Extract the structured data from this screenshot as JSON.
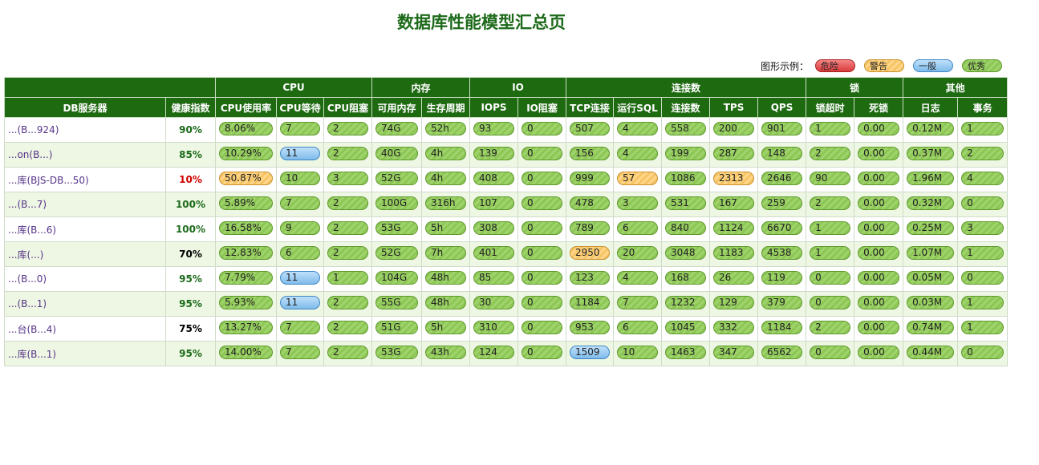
{
  "title": "数据库性能模型汇总页",
  "legend": {
    "label": "图形示例：",
    "items": [
      {
        "label": "危险",
        "level": "danger"
      },
      {
        "label": "警告",
        "level": "warn"
      },
      {
        "label": "一般",
        "level": "norm"
      },
      {
        "label": "优秀",
        "level": "good"
      }
    ]
  },
  "colors": {
    "header_bg": "#1e6a11",
    "alt_row": "#eef7e3",
    "good": "#8cc654",
    "warn": "#f6c463",
    "normal": "#7fbbea",
    "danger": "#d93b3b"
  },
  "table": {
    "groups": [
      "CPU",
      "内存",
      "IO",
      "连接数",
      "锁",
      "其他"
    ],
    "columns": [
      "DB服务器",
      "健康指数",
      "CPU使用率",
      "CPU等待",
      "CPU阻塞",
      "可用内存",
      "生存周期",
      "IOPS",
      "IO阻塞",
      "TCP连接",
      "运行SQL",
      "连接数",
      "TPS",
      "QPS",
      "锁超时",
      "死锁",
      "日志",
      "事务"
    ],
    "rows": [
      {
        "server": "...(B...924)",
        "health": "90%",
        "hlevel": "good",
        "cells": [
          [
            "8.06%",
            "good"
          ],
          [
            "7",
            "good"
          ],
          [
            "2",
            "good"
          ],
          [
            "74G",
            "good"
          ],
          [
            "52h",
            "good"
          ],
          [
            "93",
            "good"
          ],
          [
            "0",
            "good"
          ],
          [
            "507",
            "good"
          ],
          [
            "4",
            "good"
          ],
          [
            "558",
            "good"
          ],
          [
            "200",
            "good"
          ],
          [
            "901",
            "good"
          ],
          [
            "1",
            "good"
          ],
          [
            "0.00",
            "good"
          ],
          [
            "0.12M",
            "good"
          ],
          [
            "1",
            "good"
          ]
        ]
      },
      {
        "server": "...on(B...)",
        "health": "85%",
        "hlevel": "good",
        "cells": [
          [
            "10.29%",
            "good"
          ],
          [
            "11",
            "norm"
          ],
          [
            "2",
            "good"
          ],
          [
            "40G",
            "good"
          ],
          [
            "4h",
            "good"
          ],
          [
            "139",
            "good"
          ],
          [
            "0",
            "good"
          ],
          [
            "156",
            "good"
          ],
          [
            "4",
            "good"
          ],
          [
            "199",
            "good"
          ],
          [
            "287",
            "good"
          ],
          [
            "148",
            "good"
          ],
          [
            "2",
            "good"
          ],
          [
            "0.00",
            "good"
          ],
          [
            "0.37M",
            "good"
          ],
          [
            "2",
            "good"
          ]
        ]
      },
      {
        "server": "...库(BJS-DB...50)",
        "health": "10%",
        "hlevel": "bad",
        "cells": [
          [
            "50.87%",
            "warn"
          ],
          [
            "10",
            "good"
          ],
          [
            "3",
            "good"
          ],
          [
            "52G",
            "good"
          ],
          [
            "4h",
            "good"
          ],
          [
            "408",
            "good"
          ],
          [
            "0",
            "good"
          ],
          [
            "999",
            "good"
          ],
          [
            "57",
            "warn"
          ],
          [
            "1086",
            "good"
          ],
          [
            "2313",
            "warn"
          ],
          [
            "2646",
            "good"
          ],
          [
            "90",
            "good"
          ],
          [
            "0.00",
            "good"
          ],
          [
            "1.96M",
            "good"
          ],
          [
            "4",
            "good"
          ]
        ]
      },
      {
        "server": "...(B...7)",
        "health": "100%",
        "hlevel": "good",
        "cells": [
          [
            "5.89%",
            "good"
          ],
          [
            "7",
            "good"
          ],
          [
            "2",
            "good"
          ],
          [
            "100G",
            "good"
          ],
          [
            "316h",
            "good"
          ],
          [
            "107",
            "good"
          ],
          [
            "0",
            "good"
          ],
          [
            "478",
            "good"
          ],
          [
            "3",
            "good"
          ],
          [
            "531",
            "good"
          ],
          [
            "167",
            "good"
          ],
          [
            "259",
            "good"
          ],
          [
            "2",
            "good"
          ],
          [
            "0.00",
            "good"
          ],
          [
            "0.32M",
            "good"
          ],
          [
            "0",
            "good"
          ]
        ]
      },
      {
        "server": "...库(B...6)",
        "health": "100%",
        "hlevel": "good",
        "cells": [
          [
            "16.58%",
            "good"
          ],
          [
            "9",
            "good"
          ],
          [
            "2",
            "good"
          ],
          [
            "53G",
            "good"
          ],
          [
            "5h",
            "good"
          ],
          [
            "308",
            "good"
          ],
          [
            "0",
            "good"
          ],
          [
            "789",
            "good"
          ],
          [
            "6",
            "good"
          ],
          [
            "840",
            "good"
          ],
          [
            "1124",
            "good"
          ],
          [
            "6670",
            "good"
          ],
          [
            "1",
            "good"
          ],
          [
            "0.00",
            "good"
          ],
          [
            "0.25M",
            "good"
          ],
          [
            "3",
            "good"
          ]
        ]
      },
      {
        "server": "...库(...)",
        "health": "70%",
        "hlevel": "norm",
        "cells": [
          [
            "12.83%",
            "good"
          ],
          [
            "6",
            "good"
          ],
          [
            "2",
            "good"
          ],
          [
            "52G",
            "good"
          ],
          [
            "7h",
            "good"
          ],
          [
            "401",
            "good"
          ],
          [
            "0",
            "good"
          ],
          [
            "2950",
            "warn"
          ],
          [
            "20",
            "good"
          ],
          [
            "3048",
            "good"
          ],
          [
            "1183",
            "good"
          ],
          [
            "4538",
            "good"
          ],
          [
            "1",
            "good"
          ],
          [
            "0.00",
            "good"
          ],
          [
            "1.07M",
            "good"
          ],
          [
            "1",
            "good"
          ]
        ]
      },
      {
        "server": "...(B...0)",
        "health": "95%",
        "hlevel": "good",
        "cells": [
          [
            "7.79%",
            "good"
          ],
          [
            "11",
            "norm"
          ],
          [
            "1",
            "good"
          ],
          [
            "104G",
            "good"
          ],
          [
            "48h",
            "good"
          ],
          [
            "85",
            "good"
          ],
          [
            "0",
            "good"
          ],
          [
            "123",
            "good"
          ],
          [
            "4",
            "good"
          ],
          [
            "168",
            "good"
          ],
          [
            "26",
            "good"
          ],
          [
            "119",
            "good"
          ],
          [
            "0",
            "good"
          ],
          [
            "0.00",
            "good"
          ],
          [
            "0.05M",
            "good"
          ],
          [
            "0",
            "good"
          ]
        ]
      },
      {
        "server": "...(B...1)",
        "health": "95%",
        "hlevel": "good",
        "cells": [
          [
            "5.93%",
            "good"
          ],
          [
            "11",
            "norm"
          ],
          [
            "2",
            "good"
          ],
          [
            "55G",
            "good"
          ],
          [
            "48h",
            "good"
          ],
          [
            "30",
            "good"
          ],
          [
            "0",
            "good"
          ],
          [
            "1184",
            "good"
          ],
          [
            "7",
            "good"
          ],
          [
            "1232",
            "good"
          ],
          [
            "129",
            "good"
          ],
          [
            "379",
            "good"
          ],
          [
            "0",
            "good"
          ],
          [
            "0.00",
            "good"
          ],
          [
            "0.03M",
            "good"
          ],
          [
            "1",
            "good"
          ]
        ]
      },
      {
        "server": "...台(B...4)",
        "health": "75%",
        "hlevel": "norm",
        "cells": [
          [
            "13.27%",
            "good"
          ],
          [
            "7",
            "good"
          ],
          [
            "2",
            "good"
          ],
          [
            "51G",
            "good"
          ],
          [
            "5h",
            "good"
          ],
          [
            "310",
            "good"
          ],
          [
            "0",
            "good"
          ],
          [
            "953",
            "good"
          ],
          [
            "6",
            "good"
          ],
          [
            "1045",
            "good"
          ],
          [
            "332",
            "good"
          ],
          [
            "1184",
            "good"
          ],
          [
            "2",
            "good"
          ],
          [
            "0.00",
            "good"
          ],
          [
            "0.74M",
            "good"
          ],
          [
            "1",
            "good"
          ]
        ]
      },
      {
        "server": "...库(B...1)",
        "health": "95%",
        "hlevel": "good",
        "cells": [
          [
            "14.00%",
            "good"
          ],
          [
            "7",
            "good"
          ],
          [
            "2",
            "good"
          ],
          [
            "53G",
            "good"
          ],
          [
            "43h",
            "good"
          ],
          [
            "124",
            "good"
          ],
          [
            "0",
            "good"
          ],
          [
            "1509",
            "norm"
          ],
          [
            "10",
            "good"
          ],
          [
            "1463",
            "good"
          ],
          [
            "347",
            "good"
          ],
          [
            "6562",
            "good"
          ],
          [
            "0",
            "good"
          ],
          [
            "0.00",
            "good"
          ],
          [
            "0.44M",
            "good"
          ],
          [
            "0",
            "good"
          ]
        ]
      }
    ]
  }
}
